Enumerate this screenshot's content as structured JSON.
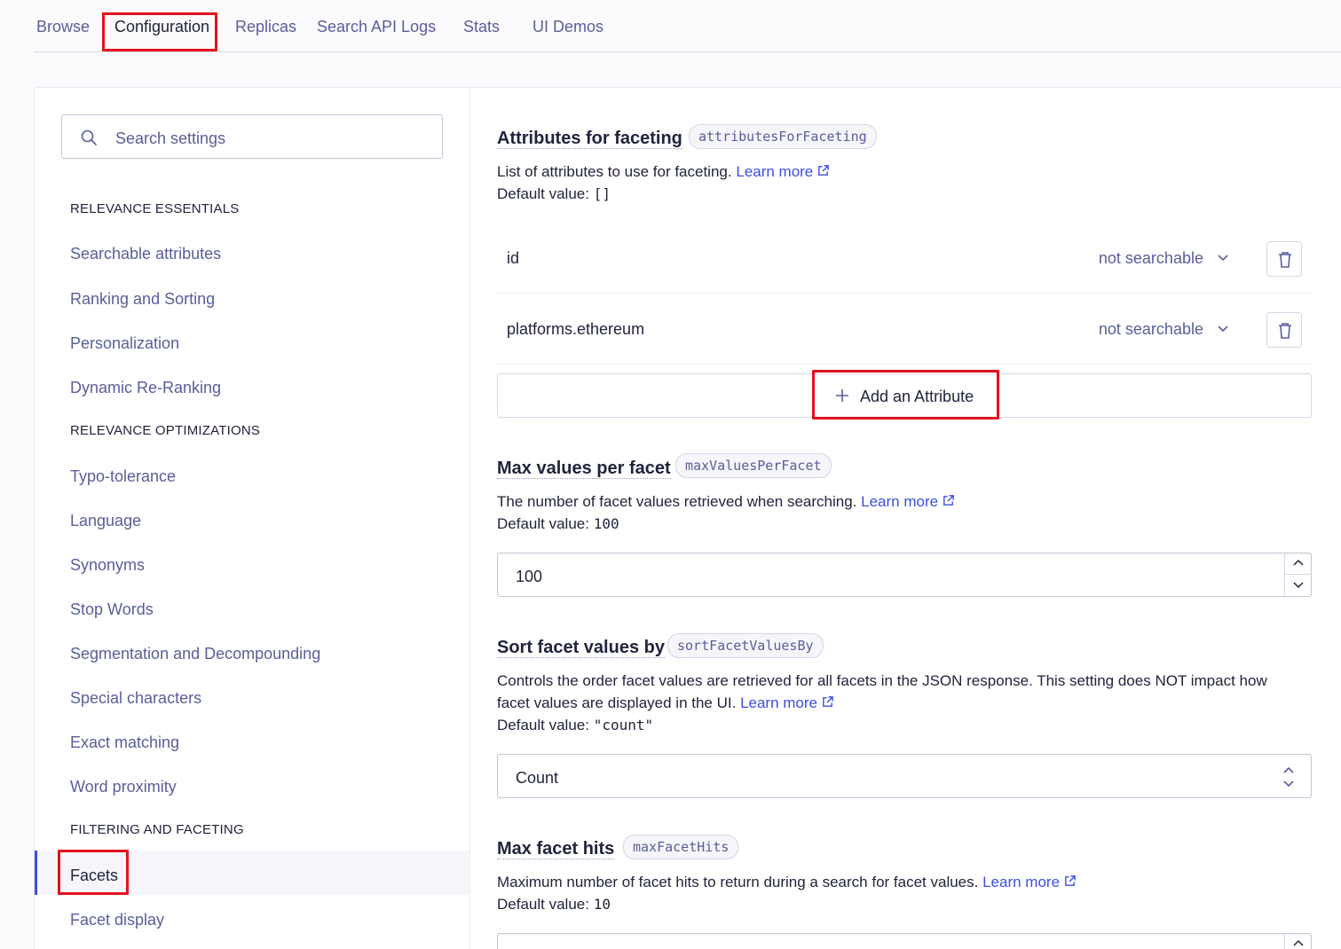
{
  "tabs": [
    {
      "label": "Browse"
    },
    {
      "label": "Configuration"
    },
    {
      "label": "Replicas"
    },
    {
      "label": "Search API Logs"
    },
    {
      "label": "Stats"
    },
    {
      "label": "UI Demos"
    }
  ],
  "sidebar": {
    "search_placeholder": "Search settings",
    "sections": [
      {
        "title": "RELEVANCE ESSENTIALS",
        "items": [
          "Searchable attributes",
          "Ranking and Sorting",
          "Personalization",
          "Dynamic Re-Ranking"
        ]
      },
      {
        "title": "RELEVANCE OPTIMIZATIONS",
        "items": [
          "Typo-tolerance",
          "Language",
          "Synonyms",
          "Stop Words",
          "Segmentation and Decompounding",
          "Special characters",
          "Exact matching",
          "Word proximity"
        ]
      },
      {
        "title": "FILTERING AND FACETING",
        "items": [
          "Facets",
          "Facet display"
        ]
      }
    ],
    "active_item": "Facets"
  },
  "settings": {
    "attributes_for_faceting": {
      "title": "Attributes for faceting",
      "code": "attributesForFaceting",
      "desc": "List of attributes to use for faceting.",
      "learn_more": "Learn more",
      "default_label": "Default value:",
      "default_value": "[]",
      "attributes": [
        {
          "name": "id",
          "mode": "not searchable"
        },
        {
          "name": "platforms.ethereum",
          "mode": "not searchable"
        }
      ],
      "add_label": "Add an Attribute"
    },
    "max_values_per_facet": {
      "title": "Max values per facet",
      "code": "maxValuesPerFacet",
      "desc": "The number of facet values retrieved when searching.",
      "learn_more": "Learn more",
      "default_label": "Default value:",
      "default_value": "100",
      "value": "100"
    },
    "sort_facet_values_by": {
      "title": "Sort facet values by",
      "code": "sortFacetValuesBy",
      "desc_line1": "Controls the order facet values are retrieved for all facets in the JSON response. This setting does NOT impact how",
      "desc_line2": "facet values are displayed in the UI.",
      "learn_more": "Learn more",
      "default_label": "Default value:",
      "default_value": "\"count\"",
      "selected": "Count"
    },
    "max_facet_hits": {
      "title": "Max facet hits",
      "code": "maxFacetHits",
      "desc": "Maximum number of facet hits to return during a search for facet values.",
      "learn_more": "Learn more",
      "default_label": "Default value:",
      "default_value": "10"
    }
  },
  "colors": {
    "accent": "#3c4fe0",
    "highlight": "#e4111e",
    "muted": "#5a5e9a"
  }
}
